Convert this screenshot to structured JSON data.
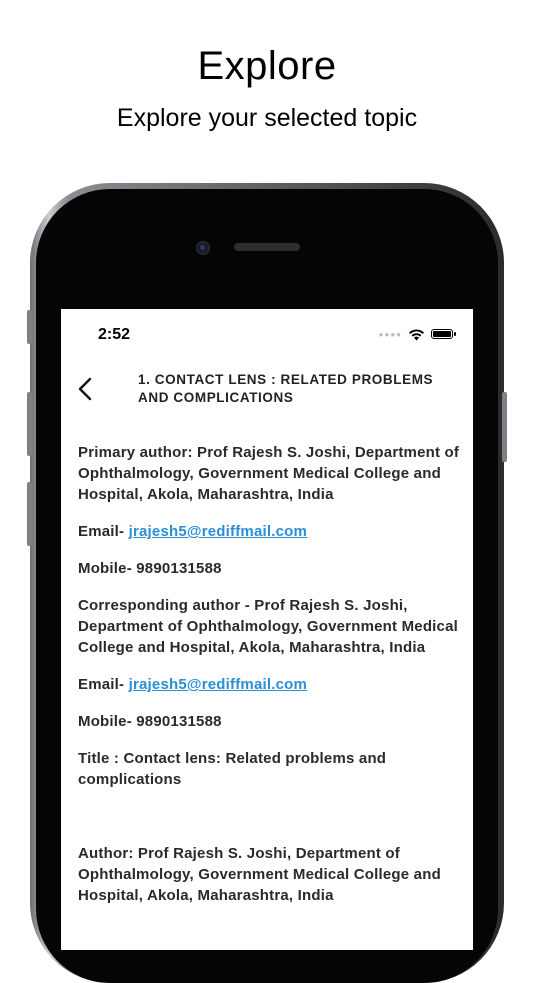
{
  "promo": {
    "title": "Explore",
    "subtitle": "Explore your selected  topic"
  },
  "status_bar": {
    "time": "2:52",
    "signal_icon": "signal-dots-icon",
    "wifi_icon": "wifi-icon",
    "battery_icon": "battery-icon"
  },
  "nav": {
    "back_icon": "chevron-left-icon",
    "title": "1. CONTACT LENS : RELATED PROBLEMS AND COMPLICATIONS"
  },
  "article": {
    "primary_author": "Primary author: Prof Rajesh S. Joshi, Department of Ophthalmology, Government Medical College and Hospital, Akola, Maharashtra, India",
    "email_label_1": "Email- ",
    "email_1": "jrajesh5@rediffmail.com",
    "mobile_1": "Mobile- 9890131588",
    "corresponding_author": "Corresponding author - Prof Rajesh S. Joshi, Department of Ophthalmology, Government Medical College and Hospital, Akola, Maharashtra, India",
    "email_label_2": "Email- ",
    "email_2": "jrajesh5@rediffmail.com",
    "mobile_2": "Mobile- 9890131588",
    "title_line": "Title : Contact lens: Related problems and complications",
    "author_line": "Author: Prof Rajesh S. Joshi, Department of Ophthalmology, Government Medical College and Hospital, Akola, Maharashtra, India"
  },
  "colors": {
    "link": "#2a8fd6",
    "text": "#2a2a2a",
    "phone_bezel": "#050505"
  }
}
